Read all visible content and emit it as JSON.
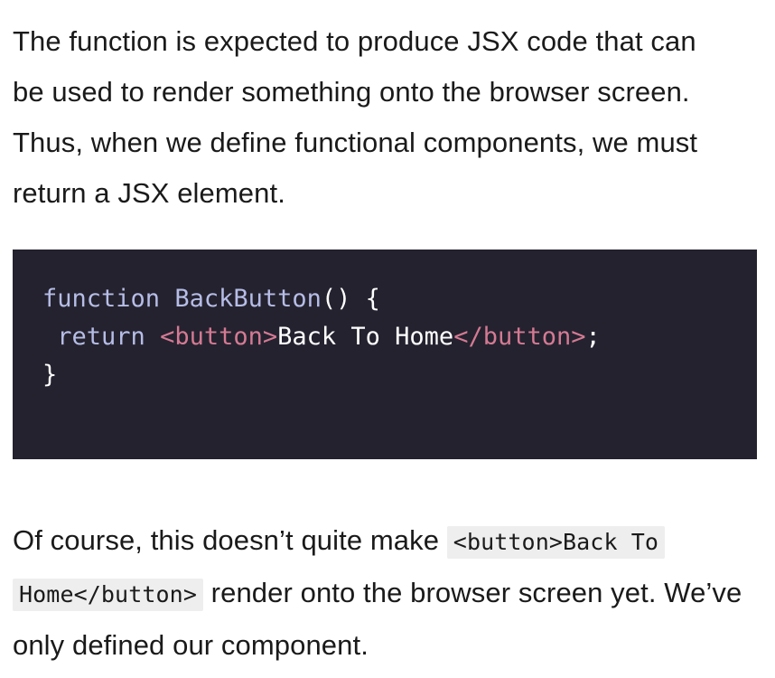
{
  "article": {
    "paragraph_1": "The function is expected to produce JSX code that can be used to render something onto the browser screen. Thus, when we define functional components, we must return a JSX element.",
    "code": {
      "line1": {
        "keyword": "function",
        "name": "BackButton",
        "punct": "() {"
      },
      "line2": {
        "indent": " ",
        "keyword": "return",
        "open_tag": "<button>",
        "text": "Back To Home",
        "close_tag": "</button>",
        "end": ";"
      },
      "line3": {
        "brace": "}"
      }
    },
    "paragraph_2": {
      "before": "Of course, this doesn’t quite make ",
      "inline_code": "<button>Back To Home</button>",
      "after": " render onto the browser screen yet. We’ve only defined our component."
    }
  },
  "colors": {
    "code_background": "#24222f",
    "keyword": "#b6bde6",
    "tag": "#d47a93",
    "code_text": "#ffffff",
    "inline_code_background": "#eeeeee"
  }
}
